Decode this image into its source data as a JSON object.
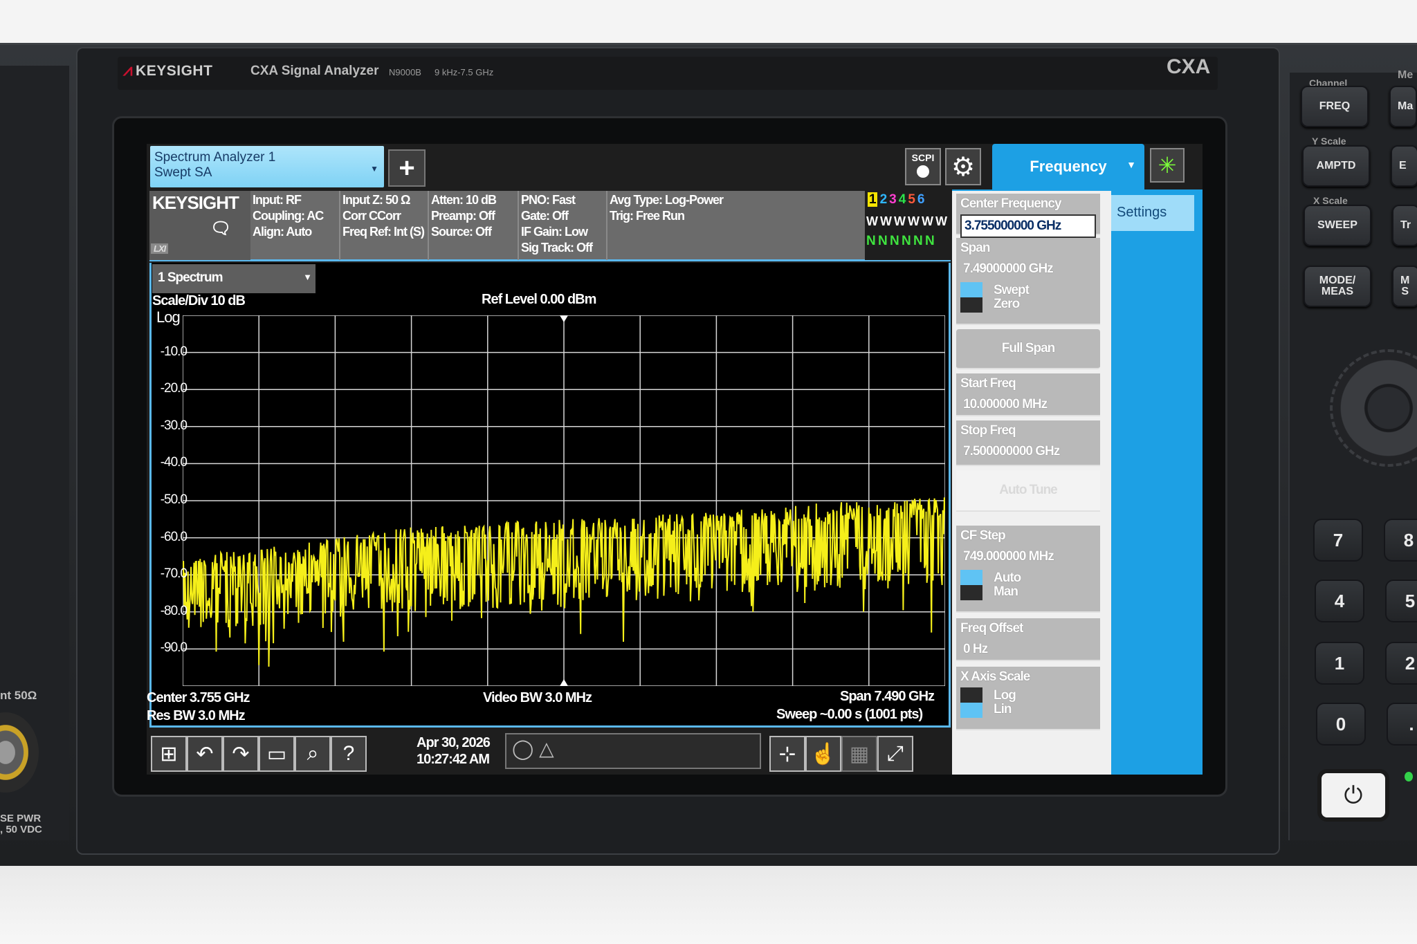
{
  "instrument": {
    "brand": "KEYSIGHT",
    "model_title": "CXA Signal Analyzer",
    "model_number": "N9000B",
    "freq_range": "9 kHz-7.5 GHz",
    "badge": "CXA",
    "left_port_label": "nt 50Ω",
    "left_pwr_label_1": "SE PWR",
    "left_pwr_label_2": ", 50 VDC"
  },
  "hardware_keys": {
    "channel_label": "Channel",
    "menu_label": "Me",
    "freq": "FREQ",
    "ma": "Ma",
    "y_scale_label": "Y Scale",
    "amptd": "AMPTD",
    "e": "E",
    "x_scale_label": "X Scale",
    "sweep": "SWEEP",
    "tr": "Tr",
    "mode_meas": "MODE/\nMEAS",
    "m_s": "M\nS",
    "numpad": [
      "7",
      "8",
      "4",
      "5",
      "1",
      "2",
      "0",
      "."
    ]
  },
  "app": {
    "tab_line1": "Spectrum Analyzer 1",
    "tab_line2": "Swept SA",
    "scpi": "SCPI",
    "menu_tab": "Frequency",
    "settings_tab": "Settings"
  },
  "info_bar": {
    "logo": "KEYSIGHT",
    "lxi": "LXI",
    "col1": [
      "Input: RF",
      "Coupling: AC",
      "Align: Auto"
    ],
    "col2": [
      "Input Z: 50 Ω",
      "Corr CCorr",
      "Freq Ref: Int (S)"
    ],
    "col3": [
      "Atten: 10 dB",
      "Preamp: Off",
      "Source: Off"
    ],
    "col4": [
      "PNO: Fast",
      "Gate: Off",
      "IF Gain: Low",
      "Sig Track: Off"
    ],
    "col5": [
      "Avg Type: Log-Power",
      "Trig: Free Run"
    ],
    "traces": [
      "1",
      "2",
      "3",
      "4",
      "5",
      "6"
    ],
    "trace_colors": [
      "#f5e400",
      "#2fb7ff",
      "#ff3fd0",
      "#2be34a",
      "#ff5a3c",
      "#3fa0ff"
    ],
    "trace_types": "W W W W W W",
    "trace_dets": "N N N N N N"
  },
  "display": {
    "window_select": "1 Spectrum",
    "scale_div": "Scale/Div 10 dB",
    "ref_level": "Ref Level 0.00 dBm",
    "scale_type": "Log",
    "y_ticks": [
      "-10.0",
      "-20.0",
      "-30.0",
      "-40.0",
      "-50.0",
      "-60.0",
      "-70.0",
      "-80.0",
      "-90.0"
    ],
    "center": "Center 3.755 GHz",
    "rbw": "Res BW 3.0 MHz",
    "vbw": "Video BW 3.0 MHz",
    "span": "Span 7.490 GHz",
    "sweep": "Sweep ~0.00 s (1001 pts)",
    "trace_color": "#f5ef1a"
  },
  "chart_data": {
    "type": "line",
    "title": "",
    "xlabel": "",
    "ylabel": "",
    "x_start_ghz": 0.01,
    "x_stop_ghz": 7.5,
    "ylim": [
      -100,
      0
    ],
    "grid": true,
    "series": [
      {
        "x_ghz": [
          0.01,
          0.76,
          1.51,
          2.26,
          3.01,
          3.76,
          4.51,
          5.26,
          6.01,
          6.76,
          7.5
        ],
        "peak_dbm": [
          -65,
          -63,
          -60,
          -57,
          -56,
          -55,
          -54,
          -53,
          -51,
          -50,
          -49
        ],
        "floor_dbm": [
          -85,
          -84,
          -82,
          -80,
          -79,
          -78,
          -77,
          -76,
          -75,
          -74,
          -73
        ]
      }
    ]
  },
  "taskbar": {
    "date": "Apr 30, 2026",
    "time": "10:27:42 AM"
  },
  "softkeys": {
    "center_freq_label": "Center Frequency",
    "center_freq_value": "3.755000000 GHz",
    "span_label": "Span",
    "span_value": "7.49000000 GHz",
    "swept": "Swept",
    "zero": "Zero",
    "full_span": "Full Span",
    "start_freq_label": "Start Freq",
    "start_freq_value": "10.000000 MHz",
    "stop_freq_label": "Stop Freq",
    "stop_freq_value": "7.500000000 GHz",
    "auto_tune": "Auto Tune",
    "cf_step_label": "CF Step",
    "cf_step_value": "749.000000 MHz",
    "auto": "Auto",
    "man": "Man",
    "freq_offset_label": "Freq Offset",
    "freq_offset_value": "0 Hz",
    "x_axis_scale_label": "X Axis Scale",
    "log": "Log",
    "lin": "Lin"
  }
}
